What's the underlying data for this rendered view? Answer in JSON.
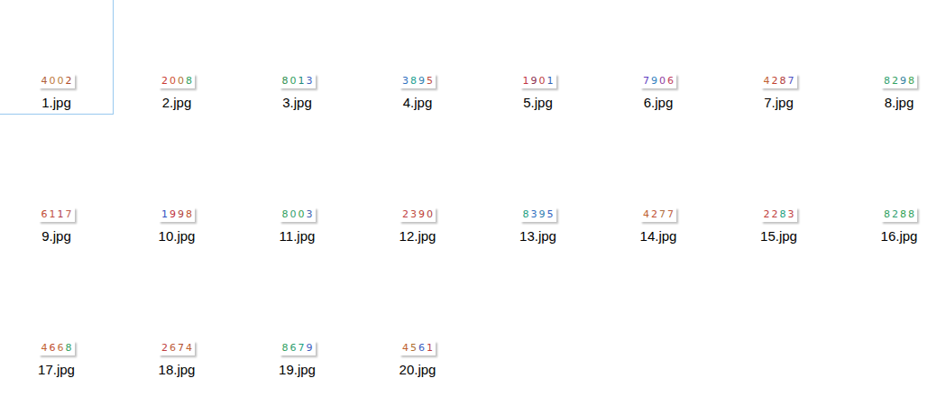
{
  "view": {
    "kind": "file-explorer-icons"
  },
  "files": [
    {
      "name": "1.jpg",
      "focused": true,
      "thumbnail": {
        "text": "4002",
        "colors": [
          "#b0603a",
          "#c07a3a",
          "#b8803a",
          "#b04a2a"
        ]
      }
    },
    {
      "name": "2.jpg",
      "focused": false,
      "thumbnail": {
        "text": "2008",
        "colors": [
          "#c83a30",
          "#d05030",
          "#b07030",
          "#30a060"
        ]
      }
    },
    {
      "name": "3.jpg",
      "focused": false,
      "thumbnail": {
        "text": "8013",
        "colors": [
          "#309050",
          "#30a060",
          "#208878",
          "#4060c0"
        ]
      }
    },
    {
      "name": "4.jpg",
      "focused": false,
      "thumbnail": {
        "text": "3895",
        "colors": [
          "#3070c0",
          "#20a090",
          "#3080b0",
          "#c04a40"
        ]
      }
    },
    {
      "name": "5.jpg",
      "focused": false,
      "thumbnail": {
        "text": "1901",
        "colors": [
          "#c03040",
          "#8a3050",
          "#c04040",
          "#3060b0"
        ]
      }
    },
    {
      "name": "6.jpg",
      "focused": false,
      "thumbnail": {
        "text": "7906",
        "colors": [
          "#6040c0",
          "#3080c0",
          "#9040a0",
          "#c04060"
        ]
      }
    },
    {
      "name": "7.jpg",
      "focused": false,
      "thumbnail": {
        "text": "4287",
        "colors": [
          "#c06030",
          "#c04030",
          "#b03a3a",
          "#5050c0"
        ]
      }
    },
    {
      "name": "8.jpg",
      "focused": false,
      "thumbnail": {
        "text": "8298",
        "colors": [
          "#30a070",
          "#30a060",
          "#3080a0",
          "#40a050"
        ]
      }
    },
    {
      "name": "9.jpg",
      "focused": false,
      "thumbnail": {
        "text": "6117",
        "colors": [
          "#c04a30",
          "#c05040",
          "#b04050",
          "#c06050"
        ]
      }
    },
    {
      "name": "10.jpg",
      "focused": false,
      "thumbnail": {
        "text": "1998",
        "colors": [
          "#3050c0",
          "#c03040",
          "#b04040",
          "#c05030"
        ]
      }
    },
    {
      "name": "11.jpg",
      "focused": false,
      "thumbnail": {
        "text": "8003",
        "colors": [
          "#30a060",
          "#30a070",
          "#30a050",
          "#4060b0"
        ]
      }
    },
    {
      "name": "12.jpg",
      "focused": false,
      "thumbnail": {
        "text": "2390",
        "colors": [
          "#c04040",
          "#c04a40",
          "#c03a30",
          "#b04040"
        ]
      }
    },
    {
      "name": "13.jpg",
      "focused": false,
      "thumbnail": {
        "text": "8395",
        "colors": [
          "#20a080",
          "#3070c0",
          "#3080b0",
          "#3060c0"
        ]
      }
    },
    {
      "name": "14.jpg",
      "focused": false,
      "thumbnail": {
        "text": "4277",
        "colors": [
          "#c06030",
          "#c05030",
          "#b07040",
          "#c06040"
        ]
      }
    },
    {
      "name": "15.jpg",
      "focused": false,
      "thumbnail": {
        "text": "2283",
        "colors": [
          "#c03a3a",
          "#c04040",
          "#20a080",
          "#c04040"
        ]
      }
    },
    {
      "name": "16.jpg",
      "focused": false,
      "thumbnail": {
        "text": "8288",
        "colors": [
          "#30a060",
          "#30a070",
          "#30a050",
          "#30a060"
        ]
      }
    },
    {
      "name": "17.jpg",
      "focused": false,
      "thumbnail": {
        "text": "4668",
        "colors": [
          "#c06030",
          "#c05030",
          "#c07040",
          "#30a060"
        ]
      }
    },
    {
      "name": "18.jpg",
      "focused": false,
      "thumbnail": {
        "text": "2674",
        "colors": [
          "#c04040",
          "#c06040",
          "#b05030",
          "#c06030"
        ]
      }
    },
    {
      "name": "19.jpg",
      "focused": false,
      "thumbnail": {
        "text": "8679",
        "colors": [
          "#30a060",
          "#30a070",
          "#20a080",
          "#4060c0"
        ]
      }
    },
    {
      "name": "20.jpg",
      "focused": false,
      "thumbnail": {
        "text": "4561",
        "colors": [
          "#c06030",
          "#b07030",
          "#4060c0",
          "#c04040"
        ]
      }
    }
  ]
}
